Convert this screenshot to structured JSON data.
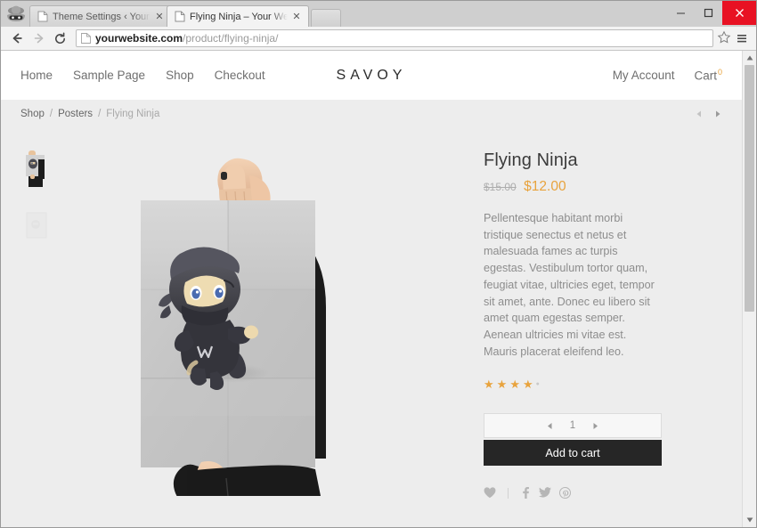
{
  "browser": {
    "tabs": [
      {
        "title": "Theme Settings ‹ Your We",
        "favicon": "page-icon",
        "close": "✕",
        "active": false
      },
      {
        "title": "Flying Ninja – Your Websi",
        "favicon": "page-icon",
        "close": "✕",
        "active": true
      }
    ],
    "window_controls": {
      "minimize": "minimize-icon",
      "maximize": "maximize-icon",
      "close": "close-icon"
    },
    "nav": {
      "back": "back-arrow-icon",
      "forward": "forward-arrow-icon",
      "reload": "reload-icon"
    },
    "url": {
      "domain": "yourwebsite.com",
      "path": "/product/flying-ninja/",
      "page_icon": "page-icon"
    },
    "bookmark_icon": "star-icon",
    "menu_icon": "hamburger-menu-icon"
  },
  "site": {
    "brand": "SAVOY",
    "nav": [
      {
        "label": "Home"
      },
      {
        "label": "Sample Page"
      },
      {
        "label": "Shop"
      },
      {
        "label": "Checkout"
      }
    ],
    "account_label": "My Account",
    "cart_label": "Cart",
    "cart_count": "0",
    "cart_count_color": "#e8a33d"
  },
  "breadcrumb": {
    "items": [
      {
        "label": "Shop",
        "current": false
      },
      {
        "label": "Posters",
        "current": false
      },
      {
        "label": "Flying Ninja",
        "current": true
      }
    ],
    "separator": "/",
    "prev_icon": "prev-arrow-icon",
    "next_icon": "next-arrow-icon"
  },
  "product": {
    "title": "Flying Ninja",
    "old_price": "$15.00",
    "new_price": "$12.00",
    "price_color": "#e8a33d",
    "description": "Pellentesque habitant morbi tristique senectus et netus et malesuada fames ac turpis egestas. Vestibulum tortor quam, feugiat vitae, ultricies eget, tempor sit amet, ante. Donec eu libero sit amet quam egestas semper. Aenean ultricies mi vitae est. Mauris placerat eleifend leo.",
    "rating": {
      "filled": 4,
      "total": 5,
      "filled_glyph": "★",
      "empty_glyph": "●"
    },
    "quantity": {
      "value": "1",
      "decrement_icon": "left-triangle-icon",
      "increment_icon": "right-triangle-icon"
    },
    "add_to_cart_label": "Add to cart",
    "social": [
      {
        "name": "wishlist-heart-icon"
      },
      {
        "name": "facebook-icon"
      },
      {
        "name": "twitter-icon"
      },
      {
        "name": "pinterest-icon"
      }
    ],
    "gallery": {
      "main_alt": "person holding flying ninja poster",
      "thumbnails": [
        {
          "name": "thumbnail-1",
          "active": true
        },
        {
          "name": "thumbnail-2",
          "active": false
        }
      ]
    }
  }
}
